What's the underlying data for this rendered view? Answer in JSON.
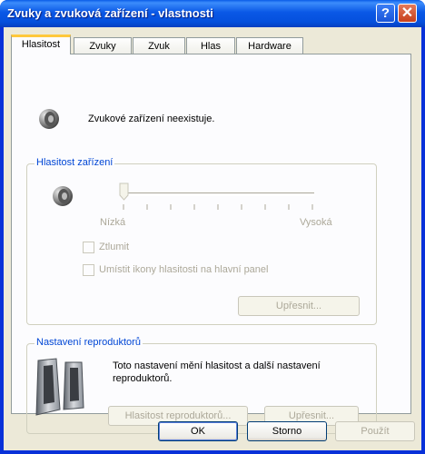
{
  "window": {
    "title": "Zvuky a zvuková zařízení - vlastnosti",
    "help_glyph": "?",
    "close_glyph": "✕"
  },
  "tabs": [
    {
      "label": "Hlasitost",
      "active": true
    },
    {
      "label": "Zvuky"
    },
    {
      "label": "Zvuk"
    },
    {
      "label": "Hlas"
    },
    {
      "label": "Hardware"
    }
  ],
  "device": {
    "message": "Zvukové zařízení neexistuje.",
    "icon": "speaker-icon"
  },
  "volume_group": {
    "title": "Hlasitost zařízení",
    "slider_min_label": "Nízká",
    "slider_max_label": "Vysoká",
    "slider_level": 0,
    "mute_label": "Ztlumit",
    "tray_icon_label": "Umístit ikony hlasitosti na hlavní panel",
    "advanced_button": "Upřesnit..."
  },
  "speaker_group": {
    "title": "Nastavení reproduktorů",
    "description_line1": "Toto nastavení mění hlasitost a další nastavení",
    "description_line2": "reproduktorů.",
    "volume_button": "Hlasitost reproduktorů...",
    "advanced_button": "Upřesnit..."
  },
  "footer": {
    "ok": "OK",
    "cancel": "Storno",
    "apply": "Použít"
  },
  "colors": {
    "title_bar": "#0a58e6",
    "group_title": "#0046d5",
    "tab_highlight": "#ffc83c",
    "face": "#ece9d8"
  }
}
